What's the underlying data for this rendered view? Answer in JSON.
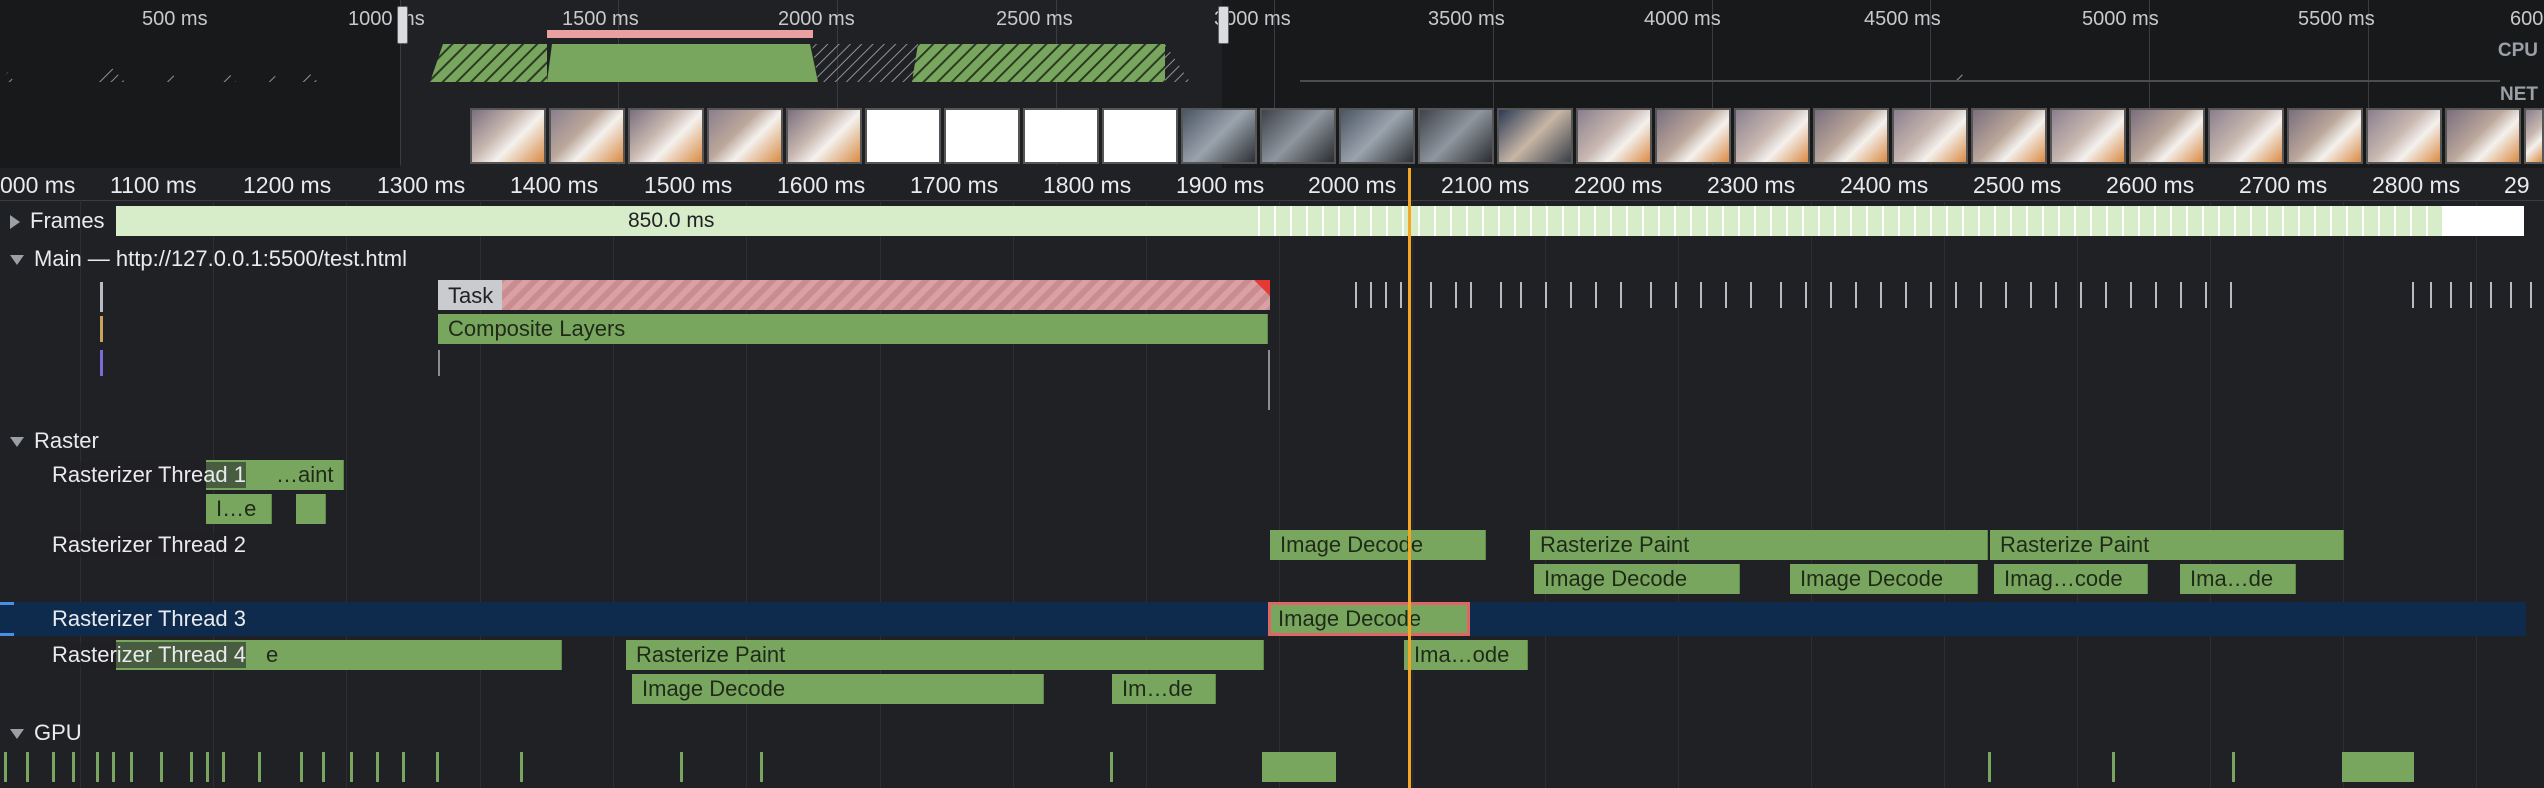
{
  "overview": {
    "ticks": [
      "500 ms",
      "1000 ms",
      "1500 ms",
      "2000 ms",
      "2500 ms",
      "3000 ms",
      "3500 ms",
      "4000 ms",
      "4500 ms",
      "5000 ms",
      "5500 ms",
      "600"
    ],
    "cpu_label": "CPU",
    "net_label": "NET"
  },
  "timeline": {
    "ticks": [
      "000 ms",
      "1100 ms",
      "1200 ms",
      "1300 ms",
      "1400 ms",
      "1500 ms",
      "1600 ms",
      "1700 ms",
      "1800 ms",
      "1900 ms",
      "2000 ms",
      "2100 ms",
      "2200 ms",
      "2300 ms",
      "2400 ms",
      "2500 ms",
      "2600 ms",
      "2700 ms",
      "2800 ms",
      "29"
    ]
  },
  "frames": {
    "label": "Frames",
    "duration": "850.0 ms"
  },
  "main": {
    "label": "Main — http://127.0.0.1:5500/test.html",
    "task": "Task",
    "composite": "Composite Layers"
  },
  "raster": {
    "label": "Raster",
    "threads": [
      "Rasterizer Thread 1",
      "Rasterizer Thread 2",
      "Rasterizer Thread 3",
      "Rasterizer Thread 4"
    ],
    "t1_bars": [
      "…aint",
      "I…e"
    ],
    "t2_bars": [
      "Image Decode",
      "Rasterize Paint",
      "Rasterize Paint",
      "Image Decode",
      "Image Decode",
      "Imag…code",
      "Ima…de"
    ],
    "t3_bars": [
      "Image Decode"
    ],
    "t4_bars": [
      "e",
      "Rasterize Paint",
      "Ima…ode",
      "Image Decode",
      "Im…de"
    ]
  },
  "gpu": {
    "label": "GPU"
  },
  "colors": {
    "background": "#202124",
    "task_green": "#78a65f",
    "selection_row": "#0e2a4d",
    "cursor": "#f5a623",
    "long_task": "#e8a0a0"
  }
}
